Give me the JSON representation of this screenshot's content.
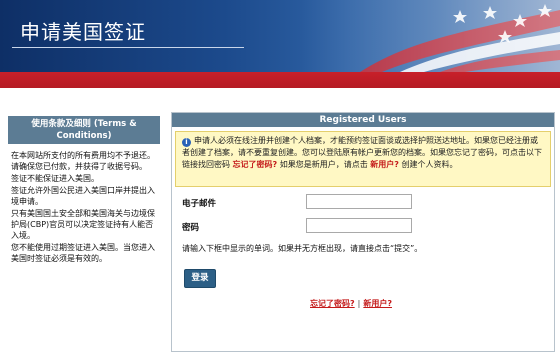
{
  "banner": {
    "title": "申请美国签证"
  },
  "colors": {
    "banner_blue": "#1c4a8c",
    "red_band": "#c8202a",
    "panel_header": "#5c7c94",
    "notice_bg": "#fff8c4",
    "link_red": "#c41a1a",
    "button_blue": "#2c5f86"
  },
  "terms": {
    "heading": "使用条款及细则 (Terms & Conditions)",
    "paragraphs": [
      "在本网站所支付的所有费用均不予退还。请确保您已付款，并获得了收据号码。",
      "签证不能保证进入美国。",
      "签证允许外国公民进入美国口岸并提出入境申请。",
      "只有美国国土安全部和美国海关与边境保护局(CBP)官员可以决定签证持有人能否入境。",
      "您不能使用过期签证进入美国。当您进入美国时签证必须是有效的。"
    ]
  },
  "login": {
    "heading": "Registered Users",
    "notice_icon": "info-icon",
    "notice_text_1": "申请人必须在线注册并创建个人档案，才能预约签证面谈或选择护照送达地址。如果您已经注册或者创建了档案，请不要重复创建。您可以登陆原有帐户更新您的档案。如果您忘记了密码，可点击以下链接找回密码",
    "notice_link_forgot": "忘记了密码?",
    "notice_text_2": "如果您是新用户，请点击",
    "notice_link_new": "新用户?",
    "notice_text_3": "创建个人资料。",
    "email_label": "电子邮件",
    "email_value": "",
    "password_label": "密码",
    "password_value": "",
    "captcha_text": "请输入下框中显示的单词。如果并无方框出现，请直接点击“提交”。",
    "submit_label": "登录",
    "forgot_link": "忘记了密码?",
    "link_separator": "|",
    "new_user_link": "新用户?"
  }
}
